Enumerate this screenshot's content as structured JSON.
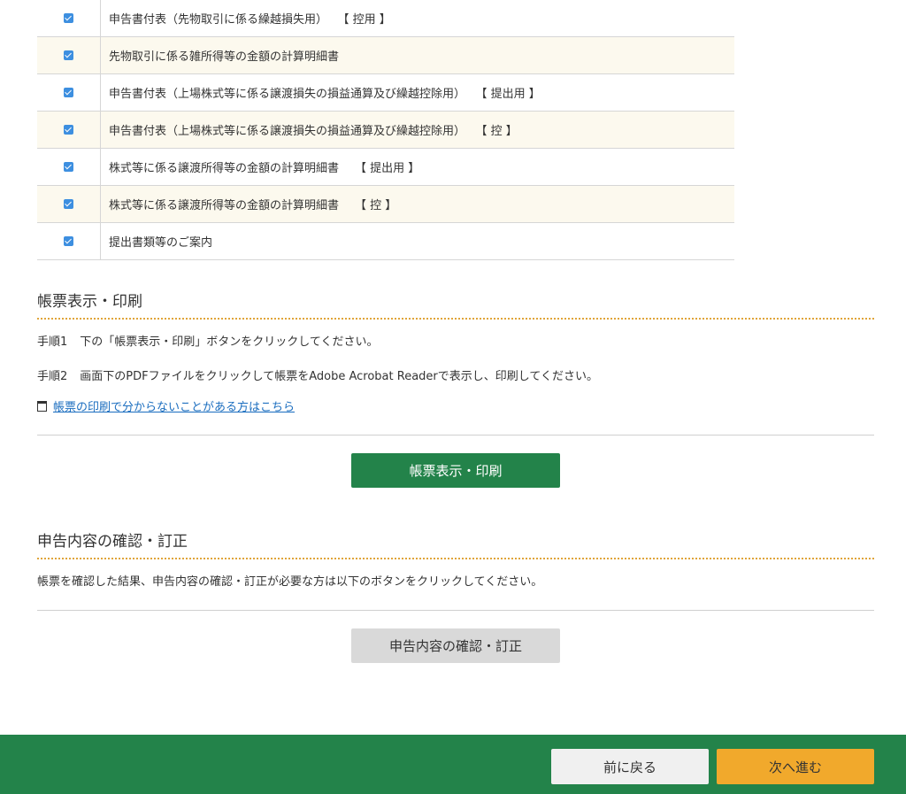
{
  "forms": [
    {
      "name": "申告書付表（先物取引に係る繰越損失用）",
      "tag": "【 控用 】",
      "checked": true
    },
    {
      "name": "先物取引に係る雑所得等の金額の計算明細書",
      "tag": "",
      "checked": true
    },
    {
      "name": "申告書付表（上場株式等に係る譲渡損失の損益通算及び繰越控除用）",
      "tag": "【 提出用 】",
      "checked": true
    },
    {
      "name": "申告書付表（上場株式等に係る譲渡損失の損益通算及び繰越控除用）",
      "tag": "【 控 】",
      "checked": true
    },
    {
      "name": "株式等に係る譲渡所得等の金額の計算明細書",
      "tag": "【 提出用 】",
      "checked": true
    },
    {
      "name": "株式等に係る譲渡所得等の金額の計算明細書",
      "tag": "【 控 】",
      "checked": true
    },
    {
      "name": "提出書類等のご案内",
      "tag": "",
      "checked": true
    }
  ],
  "print_section": {
    "heading": "帳票表示・印刷",
    "step1_label": "手順1",
    "step1_text": "下の「帳票表示・印刷」ボタンをクリックしてください。",
    "step2_label": "手順2",
    "step2_text": "画面下のPDFファイルをクリックして帳票をAdobe Acrobat Readerで表示し、印刷してください。",
    "help_link": "帳票の印刷で分からないことがある方はこちら",
    "button_label": "帳票表示・印刷"
  },
  "confirm_section": {
    "heading": "申告内容の確認・訂正",
    "description": "帳票を確認した結果、申告内容の確認・訂正が必要な方は以下のボタンをクリックしてください。",
    "button_label": "申告内容の確認・訂正"
  },
  "footer": {
    "back_label": "前に戻る",
    "next_label": "次へ進む"
  },
  "colors": {
    "primary_green": "#23834a",
    "accent_orange": "#f1a92c",
    "checkbox_blue": "#3d8fe0",
    "dotted_rule": "#e0a53a"
  }
}
